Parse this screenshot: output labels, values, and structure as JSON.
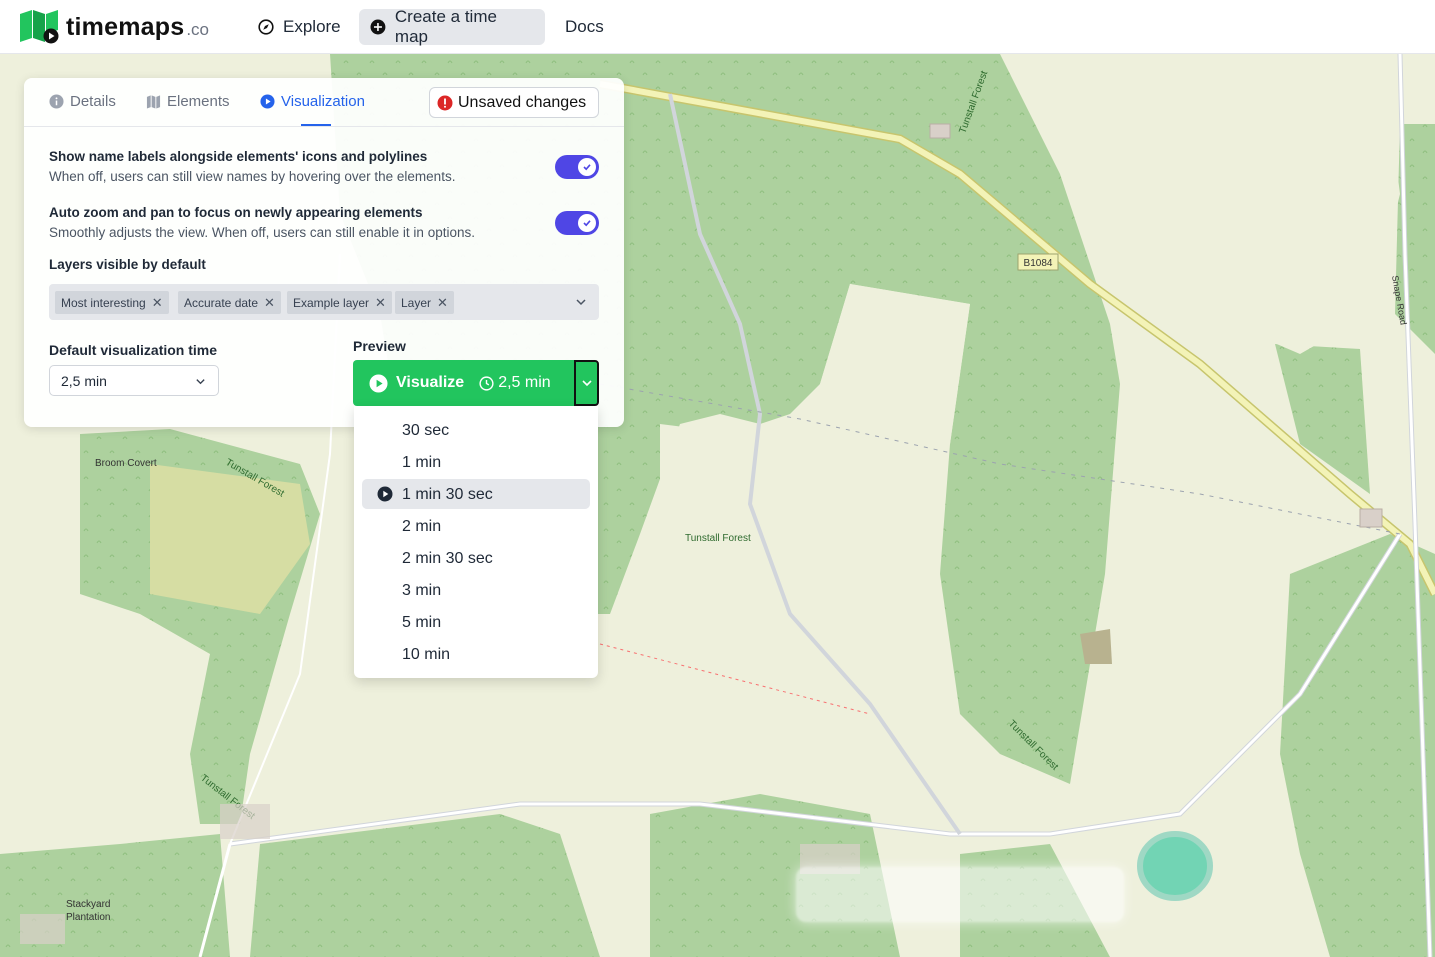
{
  "brand": {
    "name": "timemaps",
    "suffix": ".co"
  },
  "nav": {
    "explore": "Explore",
    "create": "Create a time map",
    "docs": "Docs"
  },
  "tabs": {
    "details": "Details",
    "elements": "Elements",
    "visualization": "Visualization"
  },
  "unsaved": "Unsaved changes",
  "options": [
    {
      "title": "Show name labels alongside elements' icons and polylines",
      "desc": "When off, users can still view names by hovering over the elements.",
      "enabled": true
    },
    {
      "title": "Auto zoom and pan to focus on newly appearing elements",
      "desc": "Smoothly adjusts the view. When off, users can still enable it in options.",
      "enabled": true
    }
  ],
  "layers": {
    "label": "Layers visible by default",
    "chips": [
      "Most interesting",
      "Accurate date",
      "Example layer",
      "Layer"
    ]
  },
  "default_time": {
    "label": "Default visualization time",
    "value": "2,5 min"
  },
  "preview": {
    "label": "Preview",
    "button": "Visualize",
    "time": "2,5 min"
  },
  "menu": {
    "items": [
      "30 sec",
      "1 min",
      "1 min 30 sec",
      "2 min",
      "2 min 30 sec",
      "3 min",
      "5 min",
      "10 min"
    ],
    "selected_index": 2
  },
  "map_labels": {
    "road": "B1084",
    "snape": "Snape Road",
    "broom": "Broom Covert",
    "tunstall": "Tunstall Forest",
    "stackyard1": "Stackyard",
    "stackyard2": "Plantation"
  },
  "colors": {
    "accent": "#2563eb",
    "toggle": "#4f46e5",
    "visualize": "#22c55e",
    "forest": "#add19e",
    "land": "#eef0dc",
    "alert": "#dc2626"
  }
}
